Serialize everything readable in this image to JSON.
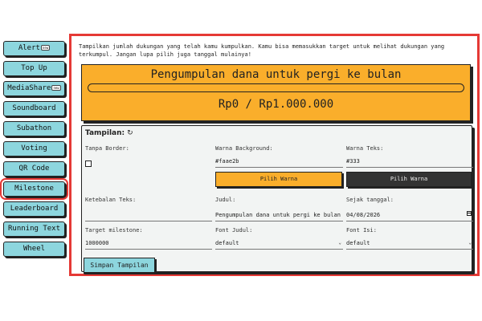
{
  "sidebar": {
    "items": [
      {
        "label": "Alert",
        "badge": "new"
      },
      {
        "label": "Top Up"
      },
      {
        "label": "MediaShare",
        "badge": "new"
      },
      {
        "label": "Soundboard"
      },
      {
        "label": "Subathon"
      },
      {
        "label": "Voting"
      },
      {
        "label": "QR Code"
      },
      {
        "label": "Milestone",
        "selected": true
      },
      {
        "label": "Leaderboard"
      },
      {
        "label": "Running Text"
      },
      {
        "label": "Wheel"
      }
    ]
  },
  "intro": "Tampilkan jumlah dukungan yang telah kamu kumpulkan. Kamu bisa memasukkan target untuk melihat dukungan yang terkumpul. Jangan lupa pilih juga tanggal mulainya!",
  "banner": {
    "title": "Pengumpulan dana untuk pergi ke bulan",
    "amount": "Rp0 / Rp1.000.000",
    "progress": 0,
    "color": "#faae2b"
  },
  "panel": {
    "title": "Tampilan:",
    "refresh_icon": "↻",
    "tanpa_border_label": "Tanpa Border:",
    "tanpa_border_checked": false,
    "warna_background_label": "Warna Background:",
    "warna_background_value": "#faae2b",
    "pilih_warna_bg_label": "Pilih Warna",
    "warna_teks_label": "Warna Teks:",
    "warna_teks_value": "#333",
    "pilih_warna_teks_label": "Pilih Warna",
    "ketebalan_teks_label": "Ketebalan Teks:",
    "ketebalan_teks_value": "",
    "judul_label": "Judul:",
    "judul_value": "Pengumpulan dana untuk pergi ke bulan",
    "sejak_tanggal_label": "Sejak tanggal:",
    "sejak_tanggal_value": "04/08/2026",
    "target_label": "Target milestone:",
    "target_value": "1000000",
    "font_judul_label": "Font Judul:",
    "font_judul_value": "default",
    "font_isi_label": "Font Isi:",
    "font_isi_value": "default",
    "save_label": "Simpan Tampilan"
  },
  "colors": {
    "accent_teal": "#8dd6de",
    "accent_orange": "#faae2b",
    "dark_button": "#333333",
    "highlight_red": "#e53935"
  }
}
